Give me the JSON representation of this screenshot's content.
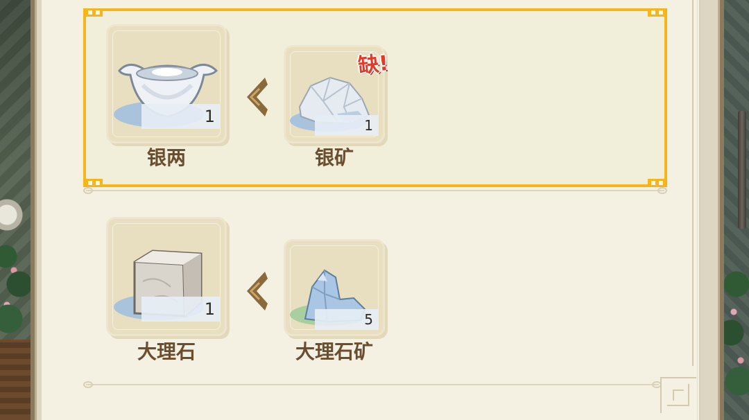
{
  "recipes": [
    {
      "selected": true,
      "output": {
        "name": "银两",
        "qty": "1",
        "icon": "silver-ingot-icon"
      },
      "input": {
        "name": "银矿",
        "qty": "1",
        "icon": "silver-ore-icon",
        "badge": "缺!"
      }
    },
    {
      "selected": false,
      "output": {
        "name": "大理石",
        "qty": "1",
        "icon": "marble-block-icon"
      },
      "input": {
        "name": "大理石矿",
        "qty": "5",
        "icon": "marble-ore-icon"
      }
    }
  ],
  "colors": {
    "selection": "#f5b51b",
    "label": "#6b4e2f",
    "missing": "#e23a2a"
  }
}
